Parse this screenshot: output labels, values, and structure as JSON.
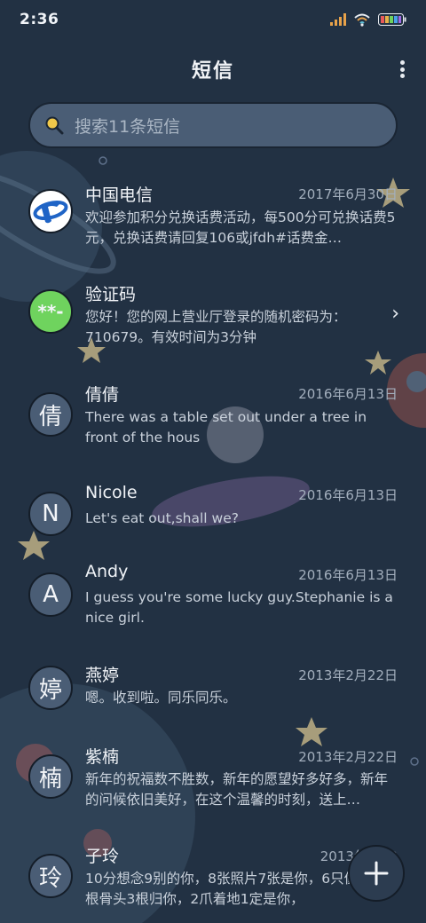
{
  "status": {
    "time": "2:36"
  },
  "header": {
    "title": "短信"
  },
  "search": {
    "placeholder": "搜索11条短信"
  },
  "conversations": [
    {
      "name": "中国电信",
      "date": "2017年6月30日",
      "snippet": "欢迎参加积分兑换话费活动，每500分可兑换话费5元，兑换话费请回复106或jfdh#话费金…",
      "avatar": "telecom-logo"
    },
    {
      "name": "验证码",
      "date": "",
      "snippet": "您好！您的网上营业厅登录的随机密码为：710679。有效时间为3分钟",
      "avatar_text": "**-"
    },
    {
      "name": "倩倩",
      "date": "2016年6月13日",
      "snippet": "There was a table set out under a tree in front of the hous",
      "avatar_text": "倩"
    },
    {
      "name": "Nicole",
      "date": "2016年6月13日",
      "snippet": "Let's eat out,shall we?",
      "avatar_text": "N"
    },
    {
      "name": "Andy",
      "date": "2016年6月13日",
      "snippet": "I guess you're some lucky guy.Stephanie is a nice girl.",
      "avatar_text": "A"
    },
    {
      "name": "燕婷",
      "date": "2013年2月22日",
      "snippet": "嗯。收到啦。同乐同乐。",
      "avatar_text": "婷"
    },
    {
      "name": "紫楠",
      "date": "2013年2月22日",
      "snippet": "新年的祝福数不胜数，新年的愿望好多好多，新年的问候依旧美好，在这个温馨的时刻，送上…",
      "avatar_text": "楠"
    },
    {
      "name": "子玲",
      "date": "2013年2月2",
      "snippet": "10分想念9别的你，8张照片7张是你，6只像你，4根骨头3根归你，2爪着地1定是你，",
      "avatar_text": "玲"
    }
  ],
  "colors": {
    "background": "#223143",
    "search_bg": "#4a5d75",
    "verify_avatar": "#6fd35e",
    "telecom_blue": "#1f64c6"
  }
}
